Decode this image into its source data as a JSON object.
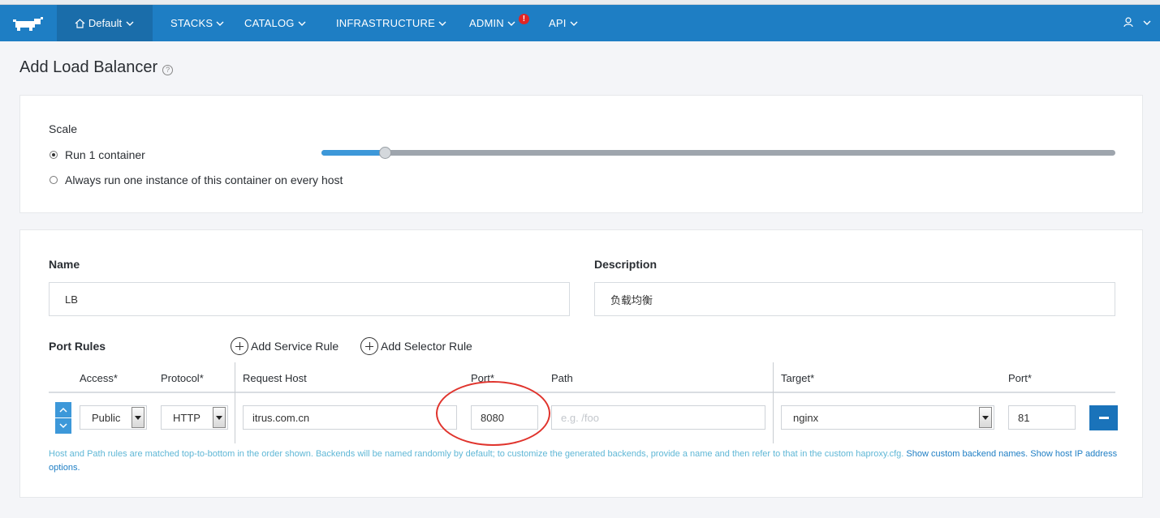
{
  "nav": {
    "environment": "Default",
    "items": [
      "STACKS",
      "CATALOG",
      "INFRASTRUCTURE",
      "ADMIN",
      "API"
    ],
    "admin_badge": "!",
    "brand_color": "#1e7ec4"
  },
  "page": {
    "title": "Add Load Balancer",
    "help_glyph": "?"
  },
  "scale": {
    "heading": "Scale",
    "option_count": "Run 1 container",
    "option_global": "Always run one instance of this container on every host",
    "selected": "count",
    "slider_fraction": 0.08
  },
  "form": {
    "name_label": "Name",
    "name_value": "LB",
    "description_label": "Description",
    "description_value": "负载均衡",
    "port_rules_label": "Port Rules",
    "add_service_rule": "Add Service Rule",
    "add_selector_rule": "Add Selector Rule"
  },
  "rules_table": {
    "headers": {
      "access": "Access*",
      "protocol": "Protocol*",
      "request_host": "Request Host",
      "port": "Port*",
      "path": "Path",
      "target": "Target*",
      "target_port": "Port*"
    },
    "row": {
      "access": "Public",
      "protocol": "HTTP",
      "request_host": "itrus.com.cn",
      "port": "8080",
      "path_placeholder": "e.g. /foo",
      "target": "nginx",
      "target_port": "81"
    }
  },
  "help": {
    "text": "Host and Path rules are matched top-to-bottom in the order shown. Backends will be named randomly by default; to customize the generated backends, provide a name and then refer to that in the custom haproxy.cfg.",
    "link_backend": "Show custom backend names.",
    "link_hostip": "Show host IP address options."
  }
}
